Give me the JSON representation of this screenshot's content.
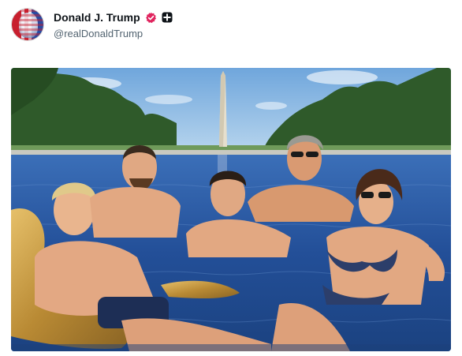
{
  "post": {
    "author": {
      "display_name": "Donald J. Trump",
      "handle": "@realDonaldTrump",
      "avatar_icon": "flag-portrait-avatar",
      "verified_icon": "verified-badge-icon",
      "extra_badge_icon": "plus-badge-icon"
    },
    "media": {
      "type": "image",
      "description_icon": "photo"
    }
  },
  "colors": {
    "name_text": "#0f1419",
    "handle_text": "#536471",
    "verified_badge": "#e0245e",
    "sky": "#7fb3e0",
    "water": "#2c5ea8",
    "trees": "#2e5a2a",
    "monument": "#e8e2d2",
    "float": "#c9a04a"
  }
}
